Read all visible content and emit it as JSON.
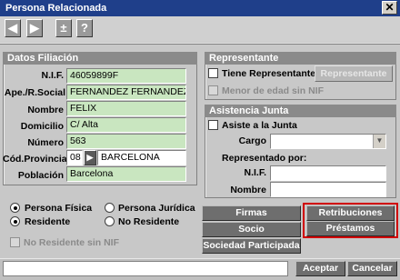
{
  "window": {
    "title": "Persona Relacionada",
    "close_label": "✕"
  },
  "toolbar": {
    "buttons": [
      "◀",
      "▶",
      "±",
      "?"
    ]
  },
  "datos": {
    "heading": "Datos Filiación",
    "fields": [
      {
        "label": "N.I.F.",
        "value": "46059899F"
      },
      {
        "label": "Ape./R.Social",
        "value": "FERNANDEZ FERNANDEZ"
      },
      {
        "label": "Nombre",
        "value": "FELIX"
      },
      {
        "label": "Domicilio",
        "value": "C/ Alta"
      },
      {
        "label": "Número",
        "value": "563"
      },
      {
        "label": "Cód.Provincial",
        "value": "08"
      },
      {
        "label": "Población",
        "value": "Barcelona"
      }
    ],
    "provincia_name": "BARCELONA",
    "provincia_button": "▶"
  },
  "options": {
    "persona_fisica": "Persona Física",
    "persona_juridica": "Persona Jurídica",
    "residente": "Residente",
    "no_residente": "No Residente",
    "no_residente_sin_nif": "No Residente sin NIF"
  },
  "representante": {
    "heading": "Representante",
    "tiene": "Tiene Representante",
    "button": "Representante",
    "menor": "Menor de edad sin NIF"
  },
  "asistencia": {
    "heading": "Asistencia Junta",
    "asiste": "Asiste a la Junta",
    "cargo_label": "Cargo",
    "representado_label": "Representado por:",
    "nif_label": "N.I.F.",
    "nombre_label": "Nombre"
  },
  "actions": {
    "firmas": "Firmas",
    "retribuciones": "Retribuciones",
    "socio": "Socio",
    "prestamos": "Préstamos",
    "sociedad": "Sociedad Participada"
  },
  "footer": {
    "aceptar": "Aceptar",
    "cancelar": "Cancelar"
  },
  "colors": {
    "title_bg": "#1f3f8a",
    "field_bg": "#c9e6c0",
    "section_bg": "#8a8a8a",
    "highlight": "#d00000"
  }
}
